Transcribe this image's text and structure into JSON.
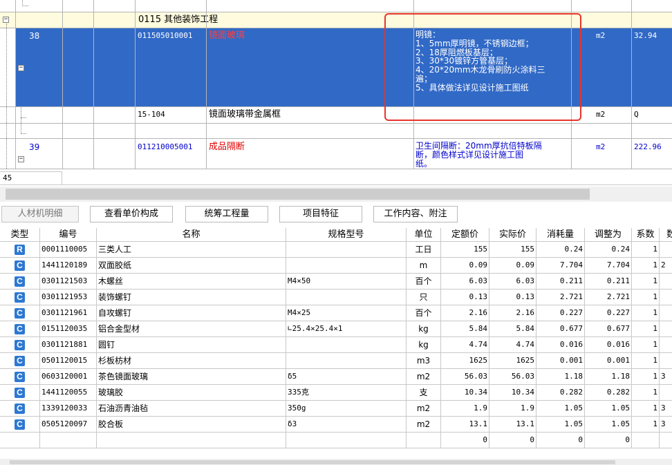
{
  "upper": {
    "group_row": {
      "code": "0115 其他装饰工程"
    },
    "rows": [
      {
        "seq": "38",
        "code": "011505010001",
        "name": "镜面玻璃",
        "features": [
          "明镜：",
          "1、5mm厚明镜，不锈钢边框；",
          "2、18厚阻燃板基层；",
          "3、30*30镀锌方管基层；",
          "4、20*20mm木龙骨刷防火涂料三",
          "遍；",
          "5、具体做法详见设计施工图纸"
        ],
        "unit": "m2",
        "qty": "32.94"
      },
      {
        "seq": "",
        "code": "15-104",
        "name": "镜面玻璃带金属框",
        "unit": "m2",
        "qty": "Q"
      },
      {
        "seq": "39",
        "code": "011210005001",
        "name": "成品隔断",
        "features": [
          "卫生间隔断：20mm厚抗倍特板隔",
          "断，颜色样式详见设计施工图",
          "纸。"
        ],
        "unit": "m2",
        "qty": "222.96"
      }
    ],
    "status_value": "45"
  },
  "tabs": [
    "人材机明细",
    "查看单价构成",
    "统筹工程量",
    "项目特征",
    "工作内容、附注"
  ],
  "grid": {
    "headers": [
      "类型",
      "编号",
      "名称",
      "规格型号",
      "单位",
      "定额价",
      "实际价",
      "消耗量",
      "调整为",
      "系数",
      "数"
    ],
    "rows": [
      {
        "type": "R",
        "code": "0001110005",
        "name": "三类人工",
        "spec": "",
        "unit": "工日",
        "base": "155",
        "actual": "155",
        "use": "0.24",
        "adj": "0.24",
        "coef": "1",
        "extra": ""
      },
      {
        "type": "C",
        "code": "1441120189",
        "name": "双面胶纸",
        "spec": "",
        "unit": "m",
        "base": "0.09",
        "actual": "0.09",
        "use": "7.704",
        "adj": "7.704",
        "coef": "1",
        "extra": "2"
      },
      {
        "type": "C",
        "code": "0301121503",
        "name": "木螺丝",
        "spec": "M4×50",
        "unit": "百个",
        "base": "6.03",
        "actual": "6.03",
        "use": "0.211",
        "adj": "0.211",
        "coef": "1",
        "extra": ""
      },
      {
        "type": "C",
        "code": "0301121953",
        "name": "装饰螺钉",
        "spec": "",
        "unit": "只",
        "base": "0.13",
        "actual": "0.13",
        "use": "2.721",
        "adj": "2.721",
        "coef": "1",
        "extra": ""
      },
      {
        "type": "C",
        "code": "0301121961",
        "name": "自攻螺钉",
        "spec": "M4×25",
        "unit": "百个",
        "base": "2.16",
        "actual": "2.16",
        "use": "0.227",
        "adj": "0.227",
        "coef": "1",
        "extra": ""
      },
      {
        "type": "C",
        "code": "0151120035",
        "name": "铝合金型材",
        "spec": "∟25.4×25.4×1",
        "unit": "kg",
        "base": "5.84",
        "actual": "5.84",
        "use": "0.677",
        "adj": "0.677",
        "coef": "1",
        "extra": ""
      },
      {
        "type": "C",
        "code": "0301121881",
        "name": "圆钉",
        "spec": "",
        "unit": "kg",
        "base": "4.74",
        "actual": "4.74",
        "use": "0.016",
        "adj": "0.016",
        "coef": "1",
        "extra": ""
      },
      {
        "type": "C",
        "code": "0501120015",
        "name": "杉板枋材",
        "spec": "",
        "unit": "m3",
        "base": "1625",
        "actual": "1625",
        "use": "0.001",
        "adj": "0.001",
        "coef": "1",
        "extra": ""
      },
      {
        "type": "C",
        "code": "0603120001",
        "name": "茶色镜面玻璃",
        "spec": "δ5",
        "unit": "m2",
        "base": "56.03",
        "actual": "56.03",
        "use": "1.18",
        "adj": "1.18",
        "coef": "1",
        "extra": "3"
      },
      {
        "type": "C",
        "code": "1441120055",
        "name": "玻璃胶",
        "spec": "335克",
        "unit": "支",
        "base": "10.34",
        "actual": "10.34",
        "use": "0.282",
        "adj": "0.282",
        "coef": "1",
        "extra": ""
      },
      {
        "type": "C",
        "code": "1339120033",
        "name": "石油沥青油毡",
        "spec": "350g",
        "unit": "m2",
        "base": "1.9",
        "actual": "1.9",
        "use": "1.05",
        "adj": "1.05",
        "coef": "1",
        "extra": "3"
      },
      {
        "type": "C",
        "code": "0505120097",
        "name": "胶合板",
        "spec": "δ3",
        "unit": "m2",
        "base": "13.1",
        "actual": "13.1",
        "use": "1.05",
        "adj": "1.05",
        "coef": "1",
        "extra": "3"
      },
      {
        "type": "",
        "code": "",
        "name": "",
        "spec": "",
        "unit": "",
        "base": "0",
        "actual": "0",
        "use": "0",
        "adj": "0",
        "coef": "",
        "extra": ""
      }
    ]
  },
  "colors": {
    "selection": "#3169c6",
    "group_row": "#fffbdf",
    "highlight_box": "#e8332a",
    "red_text": "#e00000",
    "blue_text": "#0000cc",
    "badge": "#2d78d2"
  }
}
